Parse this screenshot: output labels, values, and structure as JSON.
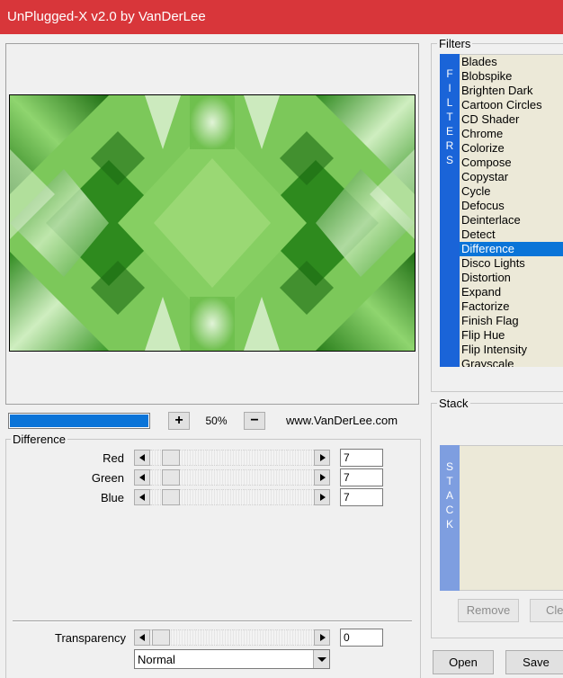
{
  "window": {
    "title": "UnPlugged-X v2.0 by VanDerLee"
  },
  "preview": {
    "progress_percent": 100
  },
  "zoom": {
    "plus_label": "+",
    "value": "50%",
    "minus_label": "−",
    "website": "www.VanDerLee.com"
  },
  "difference_group": {
    "label": "Difference",
    "sliders": [
      {
        "label": "Red",
        "value": "7"
      },
      {
        "label": "Green",
        "value": "7"
      },
      {
        "label": "Blue",
        "value": "7"
      }
    ],
    "transparency": {
      "label": "Transparency",
      "value": "0"
    },
    "blend_mode": "Normal"
  },
  "filters": {
    "label": "Filters",
    "sidebar_letters": [
      "F",
      "I",
      "L",
      "T",
      "E",
      "R",
      "S"
    ],
    "items": [
      "Blades",
      "Blobspike",
      "Brighten Dark",
      "Cartoon Circles",
      "CD Shader",
      "Chrome",
      "Colorize",
      "Compose",
      "Copystar",
      "Cycle",
      "Defocus",
      "Deinterlace",
      "Detect",
      "Difference",
      "Disco Lights",
      "Distortion",
      "Expand",
      "Factorize",
      "Finish Flag",
      "Flip Hue",
      "Flip Intensity",
      "Grayscale"
    ],
    "selected": "Difference"
  },
  "stack": {
    "label": "Stack",
    "sidebar_letters": [
      "S",
      "T",
      "A",
      "C",
      "K"
    ],
    "remove_label": "Remove",
    "clear_label": "Cle"
  },
  "buttons": {
    "open_label": "Open",
    "save_label": "Save"
  },
  "colors": {
    "titlebar": "#d8363a",
    "accent": "#0a74d8",
    "filters_sidebar": "#1a64d8",
    "stack_sidebar": "#7e9ee0",
    "list_bg": "#ece9d8"
  }
}
